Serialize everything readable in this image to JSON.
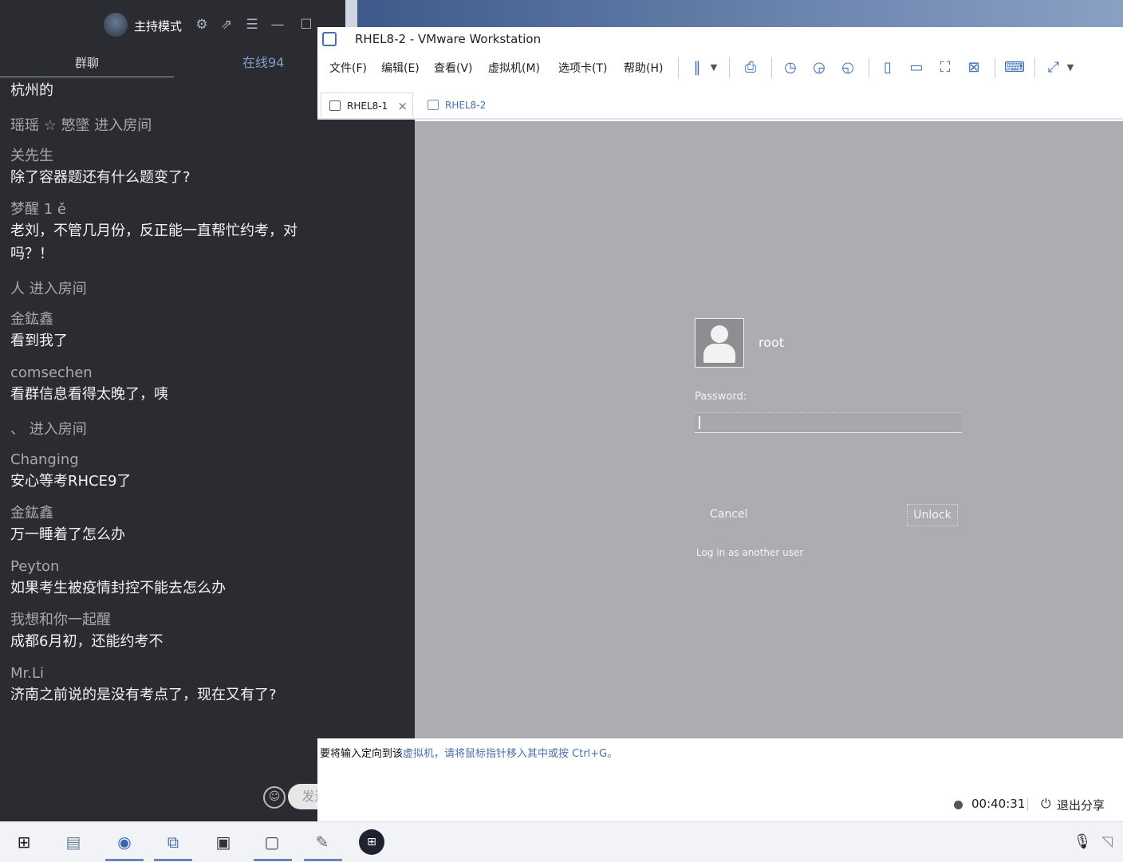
{
  "chat": {
    "mode_label": "主持模式",
    "tab_group": "群聊",
    "tab_online": "在线94",
    "first_line": "杭州的",
    "messages": [
      {
        "type": "system",
        "text": "瑶瑶 ☆ 慜墜 进入房间"
      },
      {
        "type": "msg",
        "name": "关先生",
        "text": "除了容器题还有什么题变了?"
      },
      {
        "type": "msg",
        "name": "梦醒 1 ě",
        "text": "老刘，不管几月份，反正能一直帮忙约考，对\n吗？！"
      },
      {
        "type": "system",
        "text": "人 进入房间"
      },
      {
        "type": "msg",
        "name": "金鈜鑫",
        "text": "看到我了"
      },
      {
        "type": "msg",
        "name": "comsechen",
        "text": "看群信息看得太晚了，咦"
      },
      {
        "type": "system",
        "text": "、 进入房间"
      },
      {
        "type": "msg",
        "name": "Changing",
        "text": "安心等考RHCE9了"
      },
      {
        "type": "msg",
        "name": "金鈜鑫",
        "text": "万一睡着了怎么办"
      },
      {
        "type": "msg",
        "name": "Peyton",
        "text": "如果考生被疫情封控不能去怎么办"
      },
      {
        "type": "msg",
        "name": "我想和你一起醒",
        "text": "成都6月初，还能约考不"
      },
      {
        "type": "msg",
        "name": "Mr.Li",
        "text": "济南之前说的是没有考点了，现在又有了?"
      }
    ],
    "send_label": "发送"
  },
  "vmware": {
    "title": "RHEL8-2 - VMware Workstation",
    "menu": [
      "文件(F)",
      "编辑(E)",
      "查看(V)",
      "虚拟机(M)",
      "选项卡(T)",
      "帮助(H)"
    ],
    "tabs": [
      "RHEL8-1",
      "RHEL8-2"
    ],
    "login": {
      "username": "root",
      "password_label": "Password:",
      "cancel": "Cancel",
      "unlock": "Unlock",
      "other_user": "Log in as another user"
    },
    "status_prefix": "要将输入定向到该",
    "status_rest": "虚拟机，请将鼠标指针移入其中或按 Ctrl+G。"
  },
  "share": {
    "timer": "00:40:31",
    "exit_label": "退出分享"
  },
  "colors": {
    "chat_bg": "#2b2c31",
    "vm_screen": "#adacb0",
    "accent": "#3d6fb1"
  }
}
